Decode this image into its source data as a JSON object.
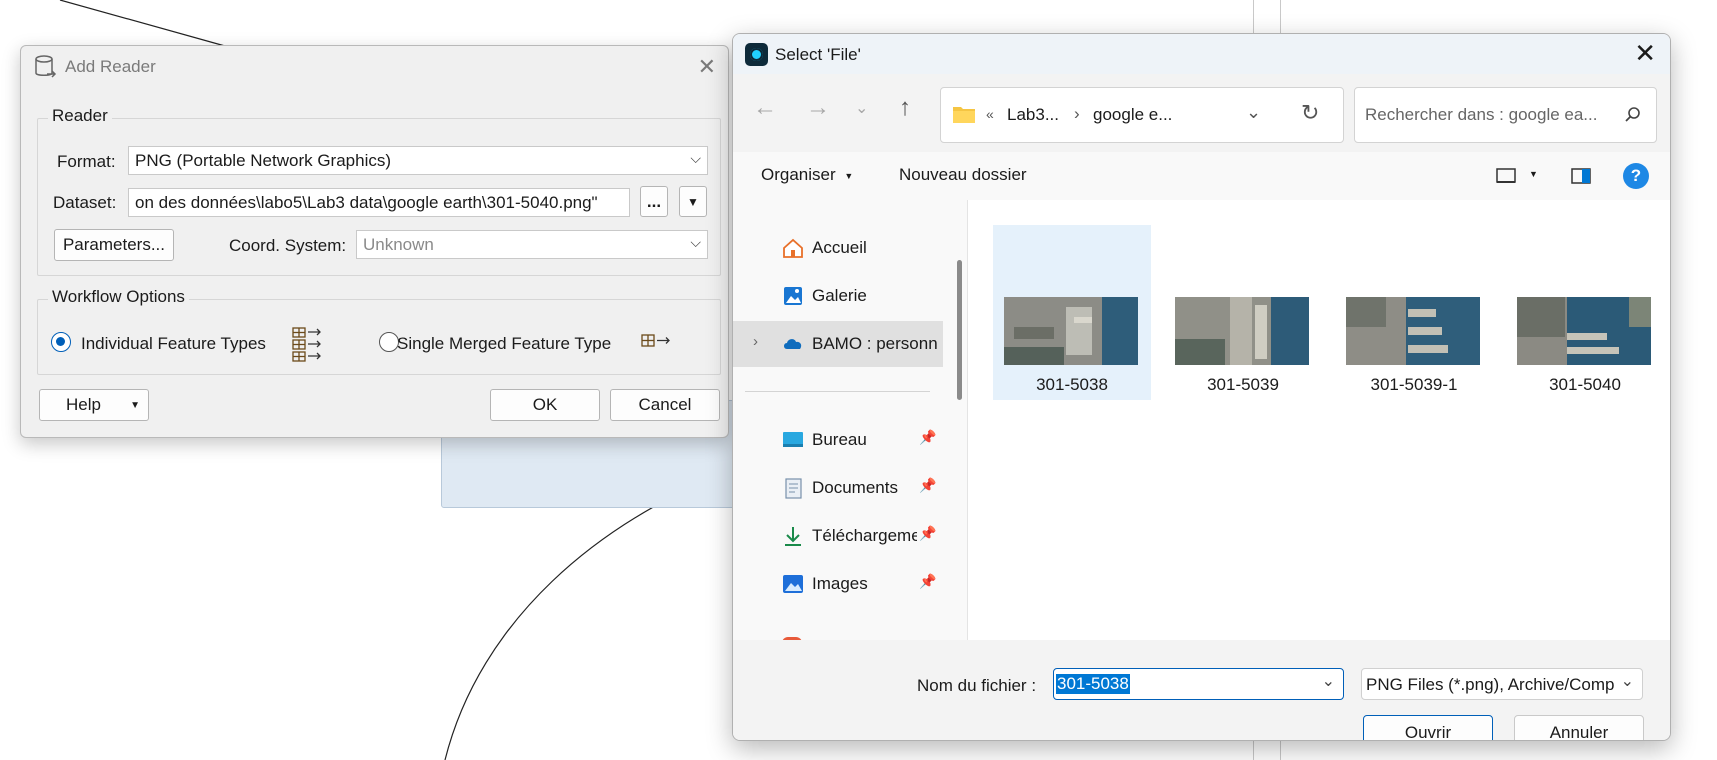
{
  "add_reader": {
    "title": "Add Reader",
    "reader_group_label": "Reader",
    "format_label": "Format:",
    "format_value": "PNG (Portable Network Graphics)",
    "dataset_label": "Dataset:",
    "dataset_value": "on des données\\labo5\\Lab3 data\\google earth\\301-5040.png\"",
    "browse_label": "...",
    "parameters_label": "Parameters...",
    "coord_label": "Coord. System:",
    "coord_value": "Unknown",
    "workflow_group_label": "Workflow Options",
    "option_individual": "Individual Feature Types",
    "option_merged": "Single Merged Feature Type",
    "selected_option": "individual",
    "help_label": "Help",
    "ok_label": "OK",
    "cancel_label": "Cancel"
  },
  "file_dialog": {
    "title": "Select 'File'",
    "breadcrumb": [
      "Lab3...",
      "google e..."
    ],
    "breadcrumb_prefix": "«",
    "search_placeholder": "Rechercher dans : google ea...",
    "toolbar": {
      "organize": "Organiser",
      "new_folder": "Nouveau dossier"
    },
    "nav_items": [
      {
        "label": "Accueil",
        "icon": "home-icon",
        "pinned": false
      },
      {
        "label": "Galerie",
        "icon": "gallery-icon",
        "pinned": false
      },
      {
        "label": "BAMO : personn",
        "icon": "cloud-icon",
        "pinned": false,
        "selected": true
      },
      {
        "label": "Bureau",
        "icon": "desktop-icon",
        "pinned": true
      },
      {
        "label": "Documents",
        "icon": "documents-icon",
        "pinned": true
      },
      {
        "label": "Téléchargeme",
        "icon": "download-icon",
        "pinned": true
      },
      {
        "label": "Images",
        "icon": "images-icon",
        "pinned": true
      }
    ],
    "files": [
      {
        "name": "301-5038",
        "selected": true
      },
      {
        "name": "301-5039",
        "selected": false
      },
      {
        "name": "301-5039-1",
        "selected": false
      },
      {
        "name": "301-5040",
        "selected": false
      }
    ],
    "filename_label": "Nom du fichier :",
    "filename_value": "301-5038",
    "filetype_value": "PNG Files (*.png), Archive/Comp",
    "open_label": "Ouvrir",
    "cancel_label": "Annuler"
  },
  "colors": {
    "accent": "#005fb8",
    "selection": "#e5f1fb"
  }
}
